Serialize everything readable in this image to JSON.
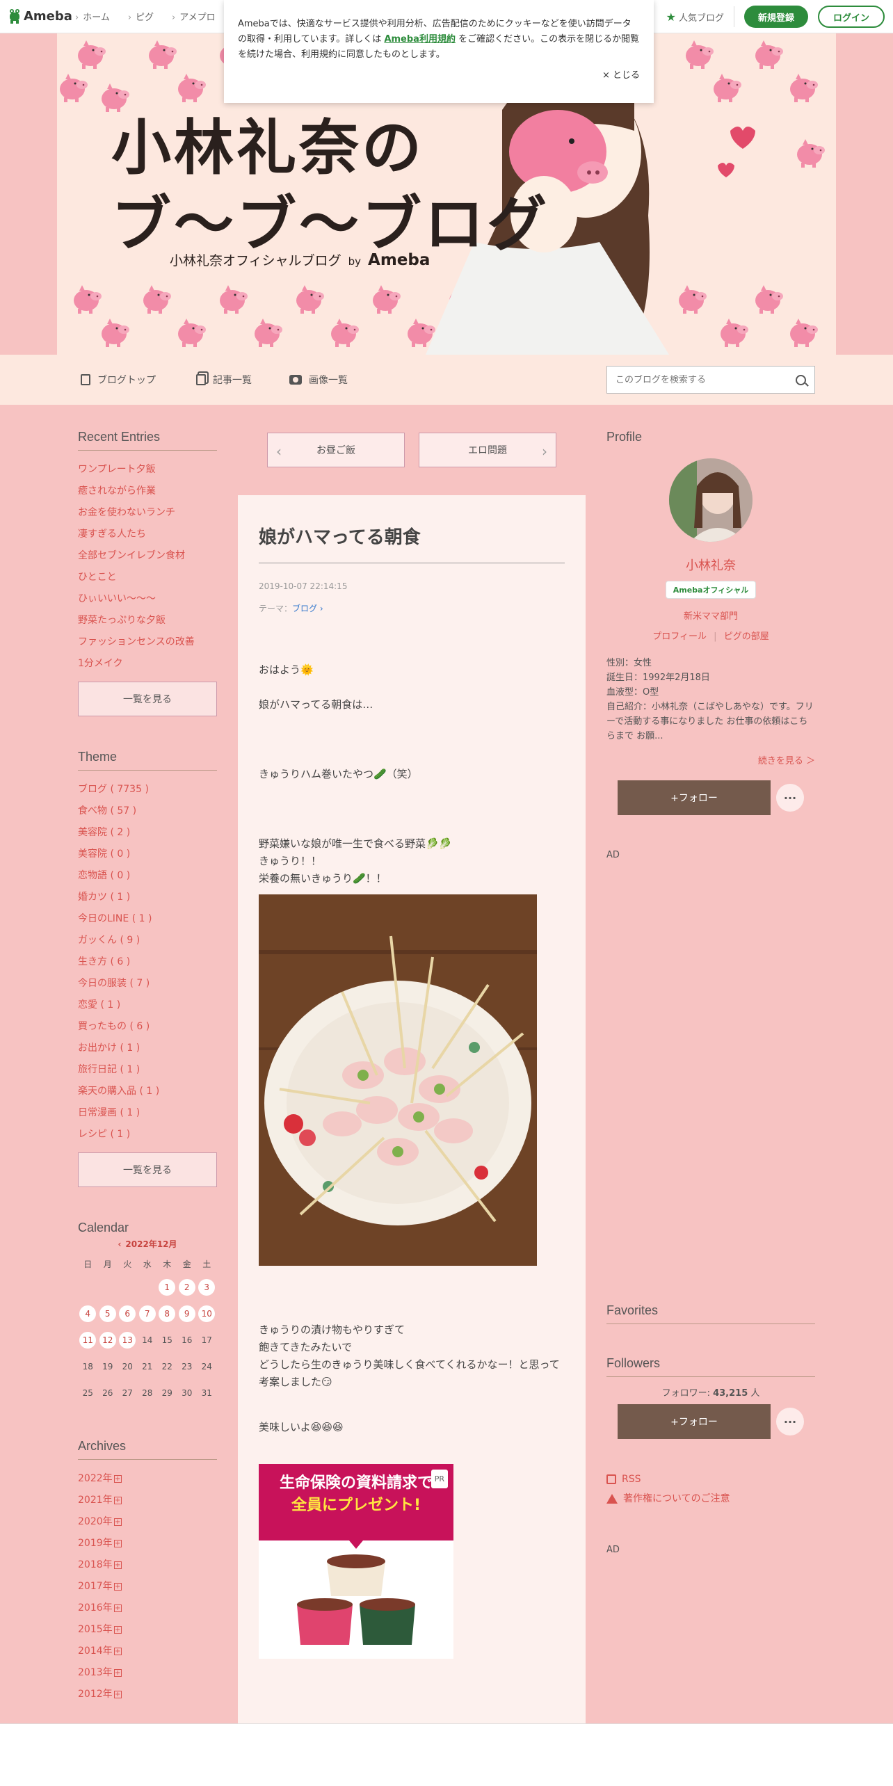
{
  "topbar": {
    "logo": "Ameba",
    "nav": [
      "ホーム",
      "ピグ",
      "アメプロ"
    ],
    "popular": "人気ブログ",
    "signup": "新規登録",
    "login": "ログイン"
  },
  "cookie": {
    "text1": "Amebaでは、快適なサービス提供や利用分析、広告配信のためにクッキーなどを使い訪問データの取得・利用しています。詳しくは",
    "link": "Ameba利用規約",
    "text2": "をご確認ください。この表示を閉じるか閲覧を続けた場合、利用規約に同意したものとします。",
    "close": "× とじる"
  },
  "banner": {
    "title_line1": "小林礼奈の",
    "title_line2": "ブ〜ブ〜ブログ",
    "subtitle": "小林礼奈オフィシャルブログ",
    "by": "by",
    "ameba": "Ameba"
  },
  "blognav": {
    "top": "ブログトップ",
    "list": "記事一覧",
    "images": "画像一覧",
    "search_placeholder": "このブログを検索する"
  },
  "recent": {
    "title": "Recent Entries",
    "items": [
      "ワンプレート夕飯",
      "癒されながら作業",
      "お金を使わないランチ",
      "凄すぎる人たち",
      "全部セブンイレブン食材",
      "ひとこと",
      "ひぃいいい〜〜〜",
      "野菜たっぷりな夕飯",
      "ファッションセンスの改善",
      "1分メイク"
    ],
    "more": "一覧を見る"
  },
  "theme": {
    "title": "Theme",
    "items": [
      "ブログ ( 7735 )",
      "食べ物 ( 57 )",
      "美容院 ( 2 )",
      "美容院 ( 0 )",
      "恋物語 ( 0 )",
      "婚カツ ( 1 )",
      "今日のLINE ( 1 )",
      "ガッくん ( 9 )",
      "生き方 ( 6 )",
      "今日の服装 ( 7 )",
      "恋愛 ( 1 )",
      "買ったもの ( 6 )",
      "お出かけ ( 1 )",
      "旅行日記 ( 1 )",
      "楽天の購入品 ( 1 )",
      "日常漫画 ( 1 )",
      "レシピ ( 1 )"
    ],
    "more": "一覧を見る"
  },
  "calendar": {
    "title": "Calendar",
    "month": "2022年12月",
    "dows": [
      "日",
      "月",
      "火",
      "水",
      "木",
      "金",
      "土"
    ],
    "weeks": [
      [
        "",
        "",
        "",
        "",
        "1",
        "2",
        "3"
      ],
      [
        "4",
        "5",
        "6",
        "7",
        "8",
        "9",
        "10"
      ],
      [
        "11",
        "12",
        "13",
        "14",
        "15",
        "16",
        "17"
      ],
      [
        "18",
        "19",
        "20",
        "21",
        "22",
        "23",
        "24"
      ],
      [
        "25",
        "26",
        "27",
        "28",
        "29",
        "30",
        "31"
      ]
    ],
    "linked_days": [
      "1",
      "2",
      "3",
      "4",
      "5",
      "6",
      "7",
      "8",
      "9",
      "10",
      "11",
      "12",
      "13"
    ]
  },
  "archives": {
    "title": "Archives",
    "items": [
      "2022年",
      "2021年",
      "2020年",
      "2019年",
      "2018年",
      "2017年",
      "2016年",
      "2015年",
      "2014年",
      "2013年",
      "2012年"
    ]
  },
  "article": {
    "prev": "お昼ご飯",
    "next": "エロ問題",
    "title": "娘がハマってる朝食",
    "date": "2019-10-07 22:14:15",
    "theme_label": "テーマ：",
    "theme": "ブログ",
    "p1": "おはよう🌞",
    "p2": "娘がハマってる朝食は…",
    "p3": "きゅうりハム巻いたやつ🥒（笑）",
    "p4a": "野菜嫌いな娘が唯一生で食べる野菜🥬🥬",
    "p4b": "きゅうり！！",
    "p4c": "栄養の無いきゅうり🥒！！",
    "p5a": "きゅうりの漬け物もやりすぎて",
    "p5b": "飽きてきたみたいで",
    "p5c": "どうしたら生のきゅうり美味しく食べてくれるかなー！と思って",
    "p5d": "考案しました😏",
    "p6": "美味しいよ😆😆😆",
    "ad_line1": "生命保険の資料請求で",
    "ad_line2": "全員にプレゼント!",
    "ad_pr": "PR"
  },
  "profile": {
    "title": "Profile",
    "name": "小林礼奈",
    "badge": "Amebaオフィシャル",
    "category": "新米ママ部門",
    "link1": "プロフィール",
    "link2": "ピグの部屋",
    "gender": "性別：女性",
    "birthday": "誕生日：1992年2月18日",
    "blood": "血液型：O型",
    "intro": "自己紹介：小林礼奈（こばやしあやな）です。フリーで活動する事になりました お仕事の依頼はこちらまで お願...",
    "more": "続きを見る ＞",
    "follow": "+フォロー",
    "ad": "AD"
  },
  "favorites": {
    "title": "Favorites"
  },
  "followers": {
    "title": "Followers",
    "count_label": "フォロワー:",
    "count": "43,215",
    "unit": "人",
    "follow": "+フォロー"
  },
  "misc": {
    "rss": "RSS",
    "copyright": "著作権についてのご注意",
    "ad": "AD"
  },
  "colors": {
    "page_bg": "#f7c3c2",
    "accent": "#d9534f",
    "ameba_green": "#2d8c3c",
    "follow_brown": "#745a4c"
  }
}
